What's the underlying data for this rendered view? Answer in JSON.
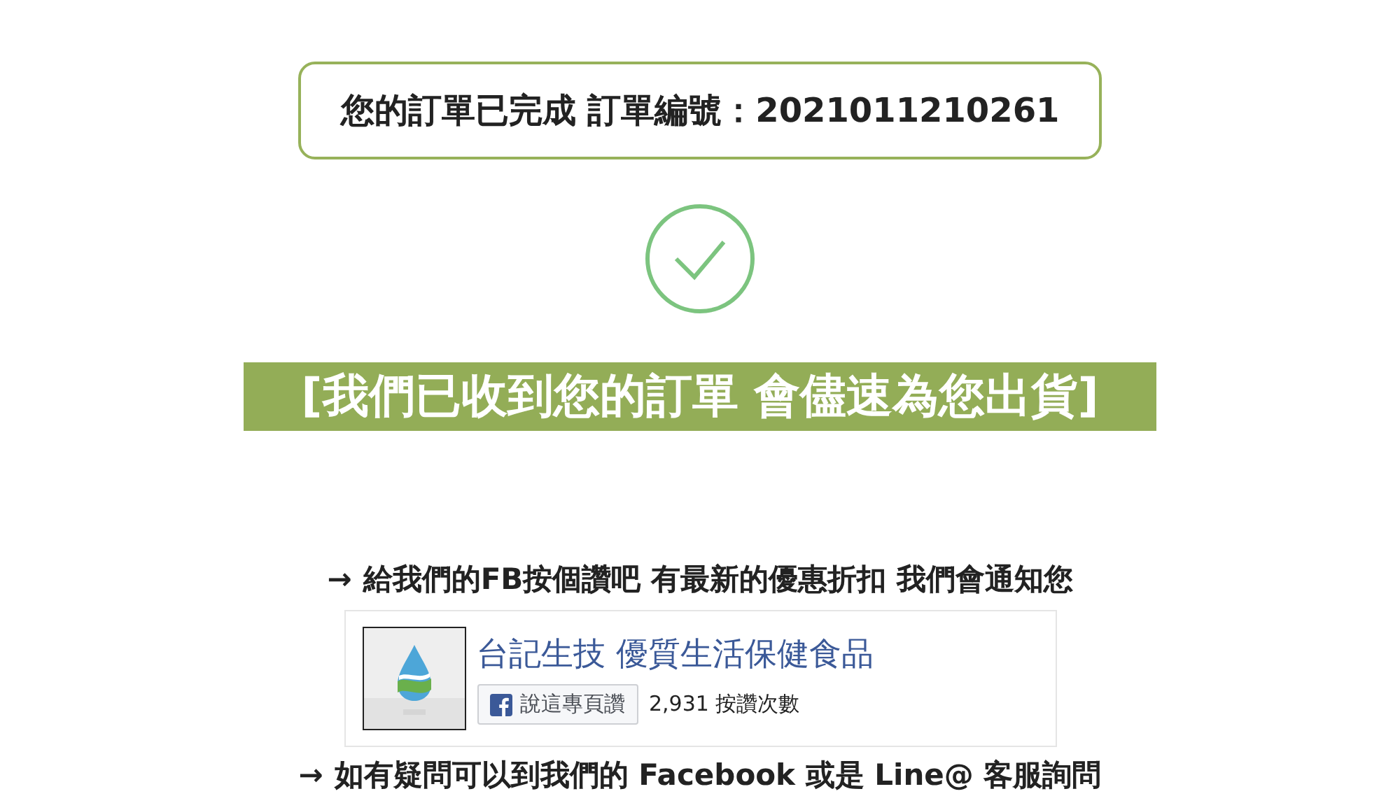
{
  "order_box": {
    "text": "您的訂單已完成 訂單編號：2021011210261"
  },
  "banner": {
    "text": "[我們已收到您的訂單 會儘速為您出貨]"
  },
  "fb_prompt": {
    "arrow": "→",
    "text": "給我們的FB按個讚吧 有最新的優惠折扣 我們會通知您"
  },
  "fb_widget": {
    "page_name": "台記生技 優質生活保健食品",
    "like_button": "說這專頁讚",
    "like_count": "2,931 按讚次數"
  },
  "contact_prompt": {
    "arrow": "→",
    "text": "如有疑問可以到我們的 Facebook 或是 Line@ 客服詢問"
  }
}
